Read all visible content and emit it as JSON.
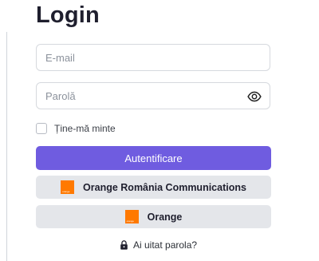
{
  "page": {
    "title": "Login"
  },
  "form": {
    "email": {
      "placeholder": "E-mail",
      "value": ""
    },
    "password": {
      "placeholder": "Parolă",
      "value": ""
    },
    "remember_label": "Ține-mă minte",
    "remember_checked": false,
    "submit_label": "Autentificare"
  },
  "sso": [
    {
      "label": "Orange România Communications",
      "logo_text": "orange",
      "icon": "orange-logo-icon"
    },
    {
      "label": "Orange",
      "logo_text": "orange",
      "icon": "orange-logo-icon"
    }
  ],
  "forgot": {
    "label": "Ai uitat parola?",
    "icon": "lock-icon"
  },
  "icons": {
    "password_toggle": "eye-icon"
  },
  "colors": {
    "primary": "#6f5ce0",
    "secondary_bg": "#e4e6ea",
    "brand_orange": "#ff7900",
    "border": "#d6d9de"
  }
}
